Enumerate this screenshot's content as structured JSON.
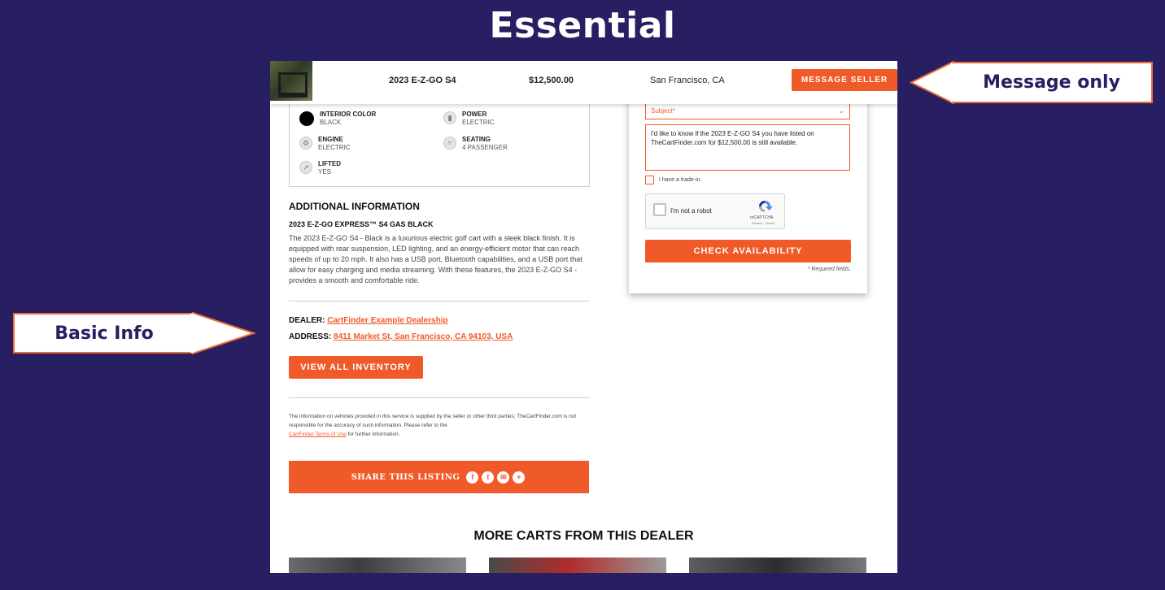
{
  "slide": {
    "title": "Essential",
    "callouts": {
      "message": "Message only",
      "basic": "Basic Info"
    }
  },
  "colors": {
    "background": "#271f62",
    "accent": "#f05a28",
    "callout_border": "#ee6b3a"
  },
  "topbar": {
    "model": "2023 E-Z-GO S4",
    "price": "$12,500.00",
    "location": "San Francisco, CA",
    "message_button": "MESSAGE SELLER"
  },
  "specs": [
    {
      "label": "INTERIOR COLOR",
      "value": "BLACK",
      "icon": "color-swatch-icon"
    },
    {
      "label": "POWER",
      "value": "ELECTRIC",
      "icon": "battery-icon"
    },
    {
      "label": "ENGINE",
      "value": "ELECTRIC",
      "icon": "engine-icon"
    },
    {
      "label": "SEATING",
      "value": "4 PASSENGER",
      "icon": "seat-icon"
    },
    {
      "label": "LIFTED",
      "value": "YES",
      "icon": "lift-icon"
    }
  ],
  "additional": {
    "heading": "ADDITIONAL INFORMATION",
    "subheading": "2023 E-Z-GO EXPRESS™ S4 GAS BLACK",
    "description": "The 2023 E-Z-GO S4 - Black is a luxurious electric golf cart with a sleek black finish. It is equipped with rear suspension, LED lighting, and an energy-efficient motor that can reach speeds of up to 20 mph. It also has a USB port, Bluetooth capabilities, and a USB port that allow for easy charging and media streaming. With these features, the 2023 E-Z-GO S4 - provides a smooth and comfortable ride."
  },
  "dealer": {
    "dealer_label": "DEALER:",
    "dealer_name": "CartFinder Example Dealership",
    "address_label": "ADDRESS:",
    "address": "8411 Market St, San Francisco, CA 94103, USA",
    "inventory_button": "VIEW ALL INVENTORY"
  },
  "disclaimer": {
    "text_before": "The information on vehicles provided in this service is supplied by the seller or other third parties; TheCartFinder.com is not responsible for the accuracy of such information. Please refer to the",
    "link": "CartFinder Terms of Use",
    "text_after": "for further information."
  },
  "share": {
    "label": "SHARE THIS LISTING",
    "icons": [
      "facebook-icon",
      "twitter-icon",
      "email-icon",
      "plus-icon"
    ]
  },
  "more": {
    "title": "MORE CARTS FROM THIS DEALER"
  },
  "form": {
    "subject_placeholder": "Subject*",
    "message": "I'd like to know if the 2023 E-Z-GO S4 you have listed on TheCartFinder.com for $12,500.00 is still available.",
    "trade_label": "I have a trade-in.",
    "captcha_label": "I'm not a robot",
    "captcha_brand": "reCAPTCHA",
    "captcha_terms": "Privacy - Terms",
    "submit": "CHECK AVAILABILITY",
    "required_note": "* Required fields."
  }
}
